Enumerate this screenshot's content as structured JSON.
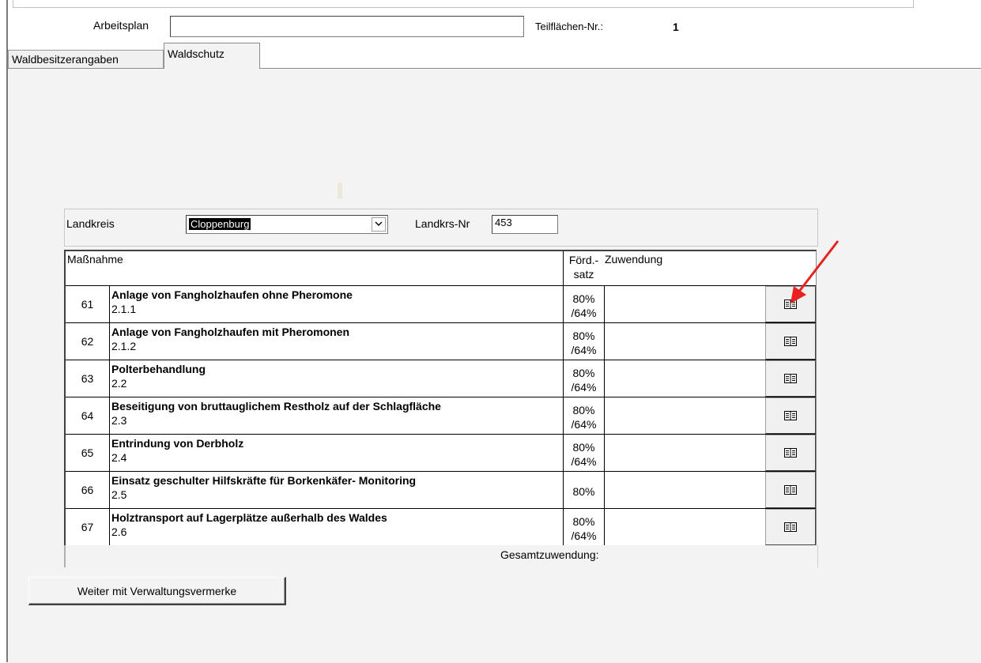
{
  "header": {
    "arbeitsplan_label": "Arbeitsplan",
    "arbeitsplan_value": "",
    "teilflaechen_label": "Teilflächen-Nr.:",
    "teilflaechen_value": "1"
  },
  "tabs": [
    {
      "label": "Waldbesitzerangaben",
      "active": false
    },
    {
      "label": "Waldschutz",
      "active": true
    }
  ],
  "landkreis": {
    "label": "Landkreis",
    "selected": "Cloppenburg",
    "nr_label": "Landkrs-Nr",
    "nr_value": "453"
  },
  "table": {
    "col_massnahme": "Maßnahme",
    "col_foerd_1": "Förd.-",
    "col_foerd_2": "satz",
    "col_zuwendung": "Zuwendung",
    "rows": [
      {
        "num": "61",
        "title": "Anlage von Fangholzhaufen ohne Pheromone",
        "code": "2.1.1",
        "rate_1": "80%",
        "rate_2": "/64%"
      },
      {
        "num": "62",
        "title": "Anlage von Fangholzhaufen mit Pheromonen",
        "code": "2.1.2",
        "rate_1": "80%",
        "rate_2": "/64%"
      },
      {
        "num": "63",
        "title": "Polterbehandlung",
        "code": "2.2",
        "rate_1": "80%",
        "rate_2": "/64%"
      },
      {
        "num": "64",
        "title": "Beseitigung von bruttauglichem Restholz auf der Schlagfläche",
        "code": "2.3",
        "rate_1": "80%",
        "rate_2": "/64%"
      },
      {
        "num": "65",
        "title": "Entrindung von Derbholz",
        "code": "2.4",
        "rate_1": "80%",
        "rate_2": "/64%"
      },
      {
        "num": "66",
        "title": "Einsatz geschulter Hilfskräfte für Borkenkäfer- Monitoring",
        "code": "2.5",
        "rate_1": "80%",
        "rate_2": ""
      },
      {
        "num": "67",
        "title": "Holztransport auf Lagerplätze außerhalb des Waldes",
        "code": "2.6",
        "rate_1": "80%",
        "rate_2": "/64%"
      }
    ],
    "gesamt_label": "Gesamtzuwendung:"
  },
  "buttons": {
    "weiter_label": "Weiter mit Verwaltungsvermerke"
  },
  "colors": {
    "annotation_arrow": "#e8231f",
    "panel_bg": "#f3f3f3"
  }
}
